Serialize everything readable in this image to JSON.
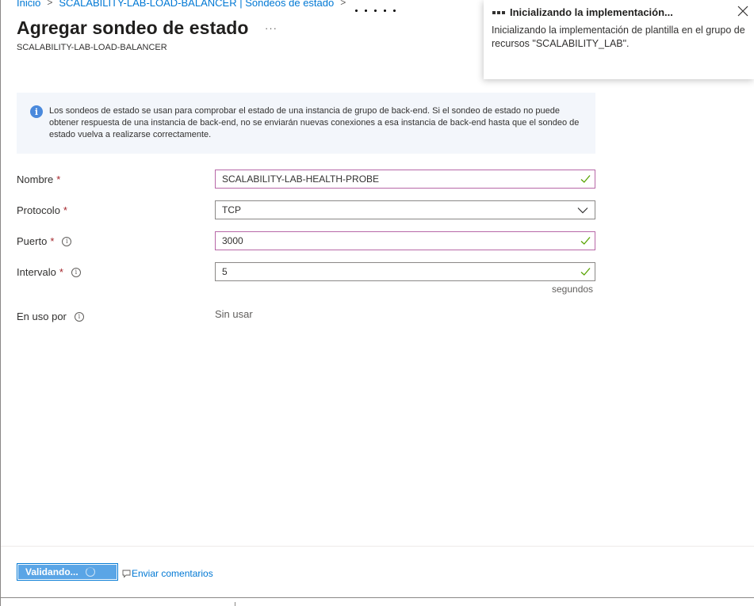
{
  "breadcrumb": {
    "home": "Inicio",
    "parent": "SCALABILITY-LAB-LOAD-BALANCER | Sondeos de estado"
  },
  "page": {
    "title": "Agregar sondeo de estado",
    "more": "···",
    "subtitle": "SCALABILITY-LAB-LOAD-BALANCER"
  },
  "info": {
    "text": "Los sondeos de estado se usan para comprobar el estado de una instancia de grupo de back-end. Si el sondeo de estado no puede obtener respuesta de una instancia de back-end, no se enviarán nuevas conexiones a esa instancia de back-end hasta que el sondeo de estado vuelva a realizarse correctamente."
  },
  "form": {
    "name": {
      "label": "Nombre",
      "value": "SCALABILITY-LAB-HEALTH-PROBE"
    },
    "protocol": {
      "label": "Protocolo",
      "value": "TCP"
    },
    "port": {
      "label": "Puerto",
      "value": "3000"
    },
    "interval": {
      "label": "Intervalo",
      "value": "5",
      "suffix": "segundos"
    },
    "in_use": {
      "label": "En uso por",
      "value": "Sin usar"
    },
    "required_marker": "*"
  },
  "footer": {
    "primary_button": "Validando...",
    "feedback_link": "Enviar comentarios"
  },
  "notification": {
    "title": "Inicializando la implementación...",
    "body": "Inicializando la implementación de plantilla en el grupo de recursos \"SCALABILITY_LAB\"."
  },
  "colors": {
    "link": "#0078d4",
    "required": "#a4262c",
    "valid_check": "#57a300",
    "valid_border": "#b768a7",
    "info_bg": "#f3f6fb",
    "primary_button_bg": "#5aa5e6"
  },
  "icons": {
    "info": "info-icon",
    "help": "help-icon",
    "check": "checkmark-icon",
    "dropdown": "chevron-down-icon",
    "feedback": "feedback-icon",
    "close": "close-icon",
    "progress": "progress-dots-icon"
  }
}
